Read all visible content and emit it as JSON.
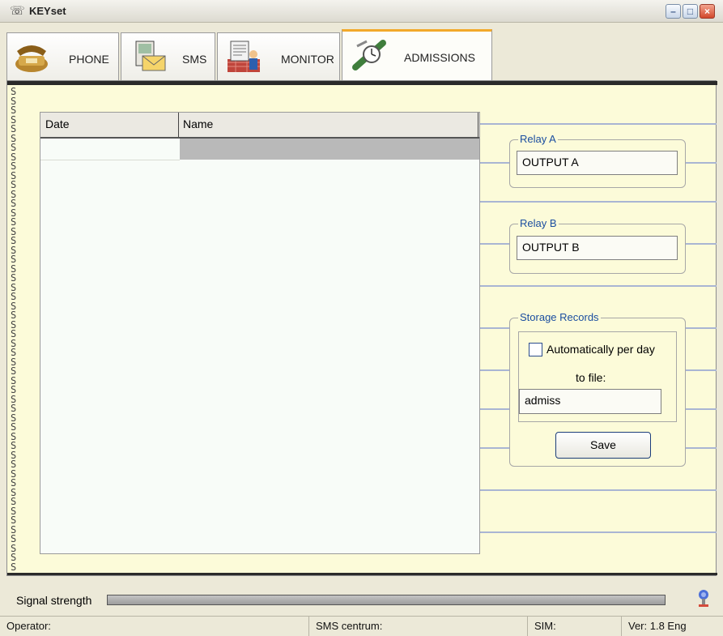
{
  "window": {
    "title": "KEYset",
    "controls": {
      "minimize": "–",
      "maximize": "□",
      "close": "×"
    }
  },
  "tabs": [
    {
      "id": "phone",
      "label": "PHONE",
      "icon": "phone-icon",
      "active": false
    },
    {
      "id": "sms",
      "label": "SMS",
      "icon": "sms-icon",
      "active": false
    },
    {
      "id": "monitor",
      "label": "MONITOR",
      "icon": "monitor-icon",
      "active": false
    },
    {
      "id": "admissions",
      "label": "ADMISSIONS",
      "icon": "admissions-icon",
      "active": true
    }
  ],
  "table": {
    "columns": [
      "Date",
      "Name"
    ],
    "rows": [
      {
        "date": "",
        "name": ""
      }
    ]
  },
  "relay_a": {
    "title": "Relay A",
    "value": "OUTPUT A"
  },
  "relay_b": {
    "title": "Relay B",
    "value": "OUTPUT B"
  },
  "storage": {
    "title": "Storage Records",
    "auto_label": "Automatically per day",
    "auto_checked": false,
    "to_file_label": "to file:",
    "file_value": "admiss",
    "save_label": "Save"
  },
  "signal": {
    "label": "Signal strength",
    "level": 0.0
  },
  "status": {
    "operator": "Operator:",
    "sms_centrum": "SMS centrum:",
    "sim": "SIM:",
    "version": "Ver: 1.8 Eng"
  },
  "colors": {
    "accent_tab": "#f2a92a",
    "group_title": "#1b4ea0",
    "paper": "#fcfbd9",
    "rule": "#a9b5d3"
  }
}
